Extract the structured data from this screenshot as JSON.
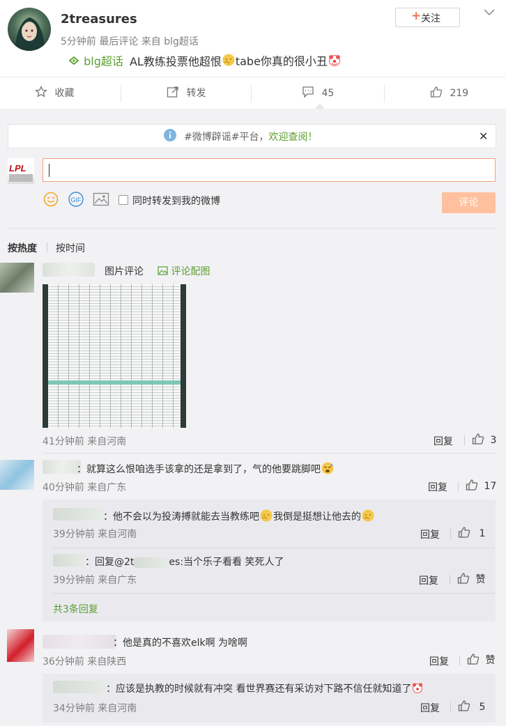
{
  "post": {
    "username": "2treasures",
    "meta": "5分钟前 最后评论 来自 blg超话",
    "follow_label": "关注",
    "tag": "blg超话",
    "text": "AL教练投票他超恨",
    "text_after": "tabe你真的很小丑"
  },
  "actions": {
    "favorite": "收藏",
    "repost": "转发",
    "comments": "45",
    "likes": "219"
  },
  "notice": {
    "text": "#微博辟谣#平台，",
    "link": "欢迎查阅！"
  },
  "composer": {
    "sync_label": "同时转发到我的微博",
    "submit_label": "评论",
    "input_value": ""
  },
  "sort": {
    "hot": "按热度",
    "time": "按时间"
  },
  "comments": [
    {
      "name": "",
      "text": "图片评论",
      "extra": "评论配图",
      "meta": "41分钟前 来自河南",
      "reply": "回复",
      "likes": "3"
    },
    {
      "name": "",
      "text": "：就算这么恨咱选手该拿的还是拿到了，气的他要跳脚吧",
      "meta": "40分钟前 来自广东",
      "reply": "回复",
      "likes": "17",
      "replies": [
        {
          "text": "：他不会以为投涛搏就能去当教练吧",
          "text2": "我倒是挺想让他去的",
          "meta": "39分钟前 来自河南",
          "reply": "回复",
          "likes": "1"
        },
        {
          "text": "：回复@2t",
          "text2": "es:当个乐子看看 笑死人了",
          "meta": "39分钟前 来自广东",
          "reply": "回复",
          "likes": "赞"
        }
      ],
      "more": "共3条回复"
    },
    {
      "name": "",
      "text": "：他是真的不喜欢elk啊 为啥啊",
      "meta": "36分钟前 来自陕西",
      "reply": "回复",
      "likes": "赞",
      "replies": [
        {
          "text": "：应该是执教的时候就有冲突 看世界赛还有采访对下路不信任就知道了",
          "meta": "34分钟前 来自河南",
          "reply": "回复",
          "likes": "5"
        }
      ]
    }
  ],
  "colors": {
    "accent": "#eb7350",
    "green": "#5a9e2f",
    "link_blue": "#2f74b7"
  }
}
